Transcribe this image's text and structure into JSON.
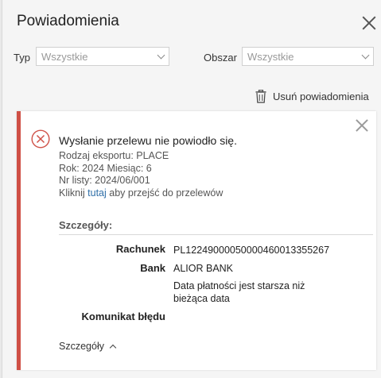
{
  "header": {
    "title": "Powiadomienia"
  },
  "filters": {
    "type_label": "Typ",
    "type_value": "Wszystkie",
    "area_label": "Obszar",
    "area_value": "Wszystkie"
  },
  "actions": {
    "remove_label": "Usuń powiadomienia"
  },
  "notification": {
    "accent_color": "#cf5046",
    "title": "Wysłanie przelewu nie powiodło się.",
    "export_type": "Rodzaj eksportu: PLACE",
    "year_month": "Rok: 2024 Miesiąc: 6",
    "list_no": "Nr listy: 2024/06/001",
    "link_prefix": "Kliknij",
    "link_text": "tutaj",
    "link_suffix": "aby przejść do przelewów",
    "details_heading": "Szczegóły:",
    "details": {
      "account_label": "Rachunek",
      "account_value": "PL12249000050000460013355267",
      "bank_label": "Bank",
      "bank_value": "ALIOR BANK",
      "message_line1": "Data płatności jest starsza niż",
      "message_line2": "bieżąca data",
      "error_label": "Komunikat błędu"
    },
    "toggle_label": "Szczegóły"
  }
}
